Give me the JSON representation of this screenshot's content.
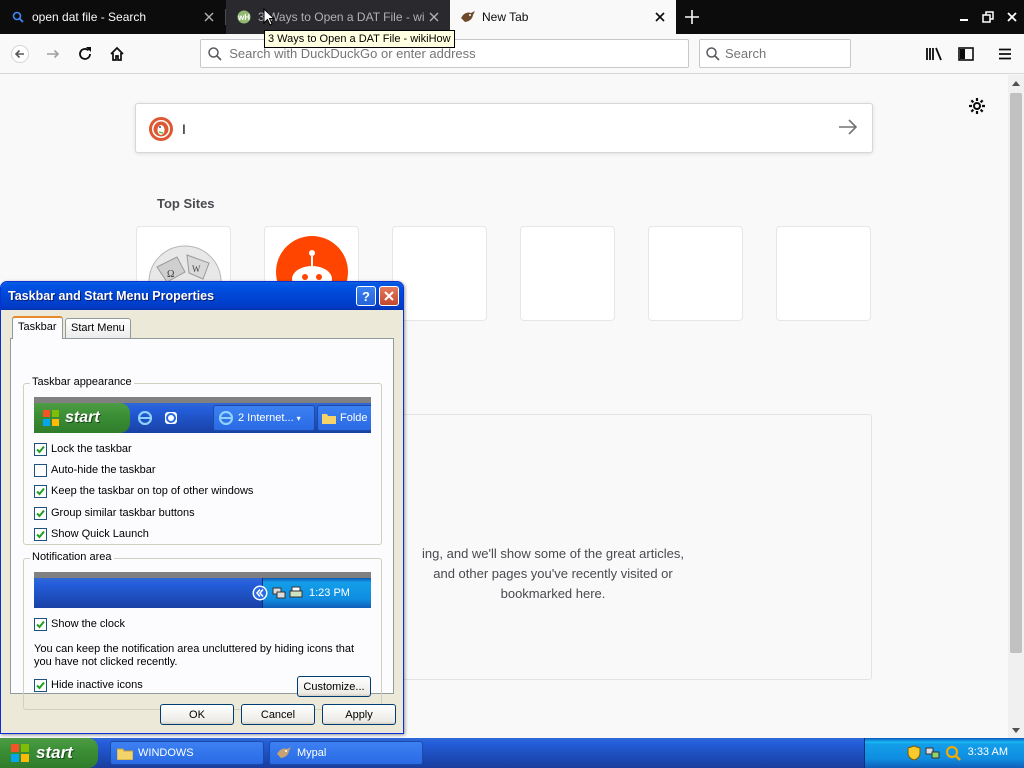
{
  "browser": {
    "tabs": [
      {
        "title": "open dat file - Search",
        "active": false
      },
      {
        "title": "3 Ways to Open a DAT File - wikiHow",
        "active": false
      },
      {
        "title": "New Tab",
        "active": true
      }
    ],
    "tooltip": "3 Ways to Open a DAT File - wikiHow",
    "urlbar_placeholder": "Search with DuckDuckGo or enter address",
    "searchbar_placeholder": "Search"
  },
  "newtab": {
    "search_caret": "I",
    "top_sites_title": "Top Sites",
    "top_sites": [
      {
        "name": "wikipedia",
        "icon": "wikipedia-globe-icon"
      },
      {
        "name": "reddit",
        "icon": "reddit-alien-icon"
      },
      {
        "name": "",
        "icon": ""
      },
      {
        "name": "",
        "icon": ""
      },
      {
        "name": "",
        "icon": ""
      },
      {
        "name": "",
        "icon": ""
      }
    ],
    "highlights_text": "ing, and we'll show some of the great articles,\nand other pages you've recently visited or\nbookmarked here."
  },
  "dialog": {
    "title": "Taskbar and Start Menu Properties",
    "tabs": [
      "Taskbar",
      "Start Menu"
    ],
    "appearance_group": "Taskbar appearance",
    "preview": {
      "start_label": "start",
      "task_label": "2 Internet...",
      "folder_label": "Folde"
    },
    "appearance_options": [
      {
        "label": "Lock the taskbar",
        "checked": true
      },
      {
        "label": "Auto-hide the taskbar",
        "checked": false
      },
      {
        "label": "Keep the taskbar on top of other windows",
        "checked": true
      },
      {
        "label": "Group similar taskbar buttons",
        "checked": true
      },
      {
        "label": "Show Quick Launch",
        "checked": true
      }
    ],
    "notification_group": "Notification area",
    "notification_preview_time": "1:23 PM",
    "show_clock": {
      "label": "Show the clock",
      "checked": true
    },
    "notification_help": "You can keep the notification area uncluttered by hiding icons that you have not clicked recently.",
    "hide_inactive": {
      "label": "Hide inactive icons",
      "checked": true
    },
    "customize_label": "Customize...",
    "ok_label": "OK",
    "cancel_label": "Cancel",
    "apply_label": "Apply"
  },
  "taskbar": {
    "start_label": "start",
    "items": [
      {
        "label": "WINDOWS",
        "icon": "folder-icon"
      },
      {
        "label": "Mypal",
        "icon": "mypal-icon"
      }
    ],
    "clock": "3:33 AM"
  }
}
